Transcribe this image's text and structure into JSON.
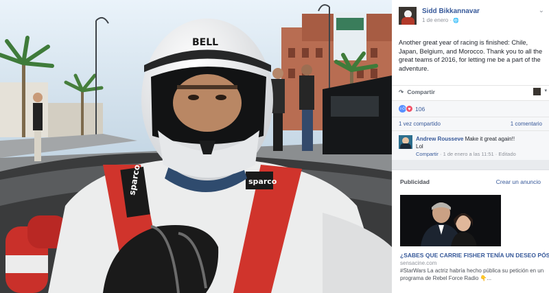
{
  "post": {
    "author": "Sidd Bikkannavar",
    "date": "1 de enero",
    "privacy_separator": "·",
    "globe_icon": "🌐",
    "text": "Another great year of racing is finished: Chile, Japan, Belgium, and Morocco. Thank you to all the great teams of 2016, for letting me be a part of the adventure.",
    "menu_icon": "⌄"
  },
  "actions": {
    "share_label": "Compartir",
    "share_icon": "↷",
    "audience_chevron": "▾"
  },
  "reactions": {
    "like_icon": "👍",
    "love_icon": "♥",
    "count": "106"
  },
  "stats": {
    "shares": "1 vez compartido",
    "comments": "1 comentario"
  },
  "comment": {
    "author": "Andrew Rousseve",
    "text": "Make it great again!!",
    "text2": "Lol",
    "share_link": "Compartir",
    "timestamp": "· 1 de enero a las 11:51 · Editado"
  },
  "ads": {
    "title": "Publicidad",
    "create": "Crear un anuncio",
    "headline": "¿SABES QUE CARRIE FISHER TENÍA UN DESEO PÓS...",
    "domain": "sensacine.com",
    "description": "#StarWars La actriz habría hecho pública su petición en un programa de Rebel Force Radio 👇..."
  },
  "photo": {
    "helmet_brand": "BELL",
    "harness_brand": "sparco",
    "sky_color": "#d7e7f3",
    "accent_red": "#d0342c"
  }
}
